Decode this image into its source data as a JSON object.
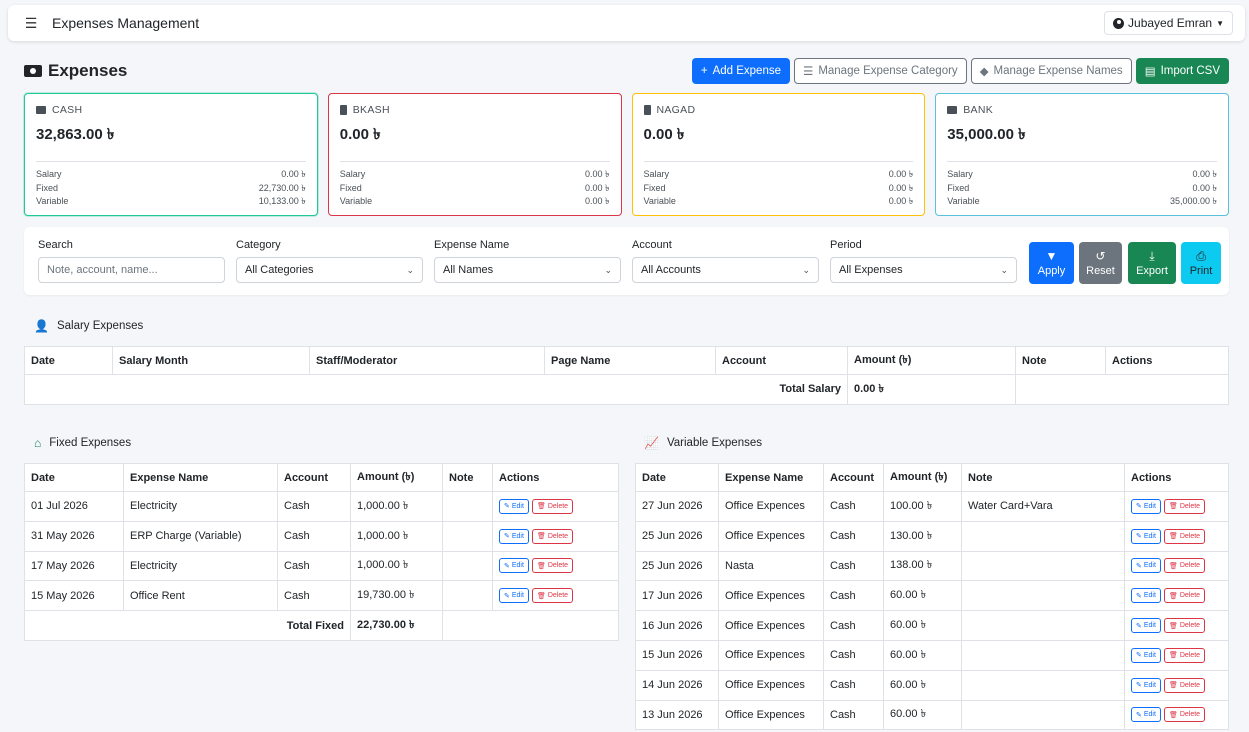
{
  "app": {
    "title": "Expenses Management",
    "user": "Jubayed Emran"
  },
  "page": {
    "title": "Expenses",
    "actions": {
      "add": "Add Expense",
      "manage_category": "Manage Expense Category",
      "manage_names": "Manage Expense Names",
      "import": "Import CSV"
    }
  },
  "accounts": [
    {
      "label": "CASH",
      "amount": "32,863.00 ৳",
      "salary": "0.00 ৳",
      "fixed": "22,730.00 ৳",
      "variable": "10,133.00 ৳"
    },
    {
      "label": "BKASH",
      "amount": "0.00 ৳",
      "salary": "0.00 ৳",
      "fixed": "0.00 ৳",
      "variable": "0.00 ৳"
    },
    {
      "label": "NAGAD",
      "amount": "0.00 ৳",
      "salary": "0.00 ৳",
      "fixed": "0.00 ৳",
      "variable": "0.00 ৳"
    },
    {
      "label": "BANK",
      "amount": "35,000.00 ৳",
      "salary": "0.00 ৳",
      "fixed": "0.00 ৳",
      "variable": "35,000.00 ৳"
    }
  ],
  "card_row_labels": {
    "salary": "Salary",
    "fixed": "Fixed",
    "variable": "Variable"
  },
  "filters": {
    "search_label": "Search",
    "search_placeholder": "Note, account, name...",
    "category_label": "Category",
    "category_value": "All Categories",
    "name_label": "Expense Name",
    "name_value": "All Names",
    "account_label": "Account",
    "account_value": "All Accounts",
    "period_label": "Period",
    "period_value": "All Expenses",
    "apply": "Apply",
    "reset": "Reset",
    "export": "Export",
    "print": "Print"
  },
  "salary": {
    "title": "Salary Expenses",
    "headers": [
      "Date",
      "Salary Month",
      "Staff/Moderator",
      "Page Name",
      "Account",
      "Amount (৳)",
      "Note",
      "Actions"
    ],
    "total_label": "Total Salary",
    "total_value": "0.00 ৳"
  },
  "fixed": {
    "title": "Fixed Expenses",
    "headers": [
      "Date",
      "Expense Name",
      "Account",
      "Amount (৳)",
      "Note",
      "Actions"
    ],
    "rows": [
      {
        "date": "01 Jul 2026",
        "name": "Electricity",
        "account": "Cash",
        "amount": "1,000.00 ৳",
        "note": ""
      },
      {
        "date": "31 May 2026",
        "name": "ERP Charge (Variable)",
        "account": "Cash",
        "amount": "1,000.00 ৳",
        "note": ""
      },
      {
        "date": "17 May 2026",
        "name": "Electricity",
        "account": "Cash",
        "amount": "1,000.00 ৳",
        "note": ""
      },
      {
        "date": "15 May 2026",
        "name": "Office Rent",
        "account": "Cash",
        "amount": "19,730.00 ৳",
        "note": ""
      }
    ],
    "total_label": "Total Fixed",
    "total_value": "22,730.00 ৳"
  },
  "variable": {
    "title": "Variable Expenses",
    "headers": [
      "Date",
      "Expense Name",
      "Account",
      "Amount (৳)",
      "Note",
      "Actions"
    ],
    "rows": [
      {
        "date": "27 Jun 2026",
        "name": "Office Expences",
        "account": "Cash",
        "amount": "100.00 ৳",
        "note": "Water Card+Vara"
      },
      {
        "date": "25 Jun 2026",
        "name": "Office Expences",
        "account": "Cash",
        "amount": "130.00 ৳",
        "note": ""
      },
      {
        "date": "25 Jun 2026",
        "name": "Nasta",
        "account": "Cash",
        "amount": "138.00 ৳",
        "note": ""
      },
      {
        "date": "17 Jun 2026",
        "name": "Office Expences",
        "account": "Cash",
        "amount": "60.00 ৳",
        "note": ""
      },
      {
        "date": "16 Jun 2026",
        "name": "Office Expences",
        "account": "Cash",
        "amount": "60.00 ৳",
        "note": ""
      },
      {
        "date": "15 Jun 2026",
        "name": "Office Expences",
        "account": "Cash",
        "amount": "60.00 ৳",
        "note": ""
      },
      {
        "date": "14 Jun 2026",
        "name": "Office Expences",
        "account": "Cash",
        "amount": "60.00 ৳",
        "note": ""
      },
      {
        "date": "13 Jun 2026",
        "name": "Office Expences",
        "account": "Cash",
        "amount": "60.00 ৳",
        "note": ""
      }
    ]
  },
  "row_actions": {
    "edit": "Edit",
    "delete": "Delete"
  },
  "colors": {
    "primary": "#0d6efd",
    "success": "#198754",
    "secondary": "#6c757d",
    "info": "#0dcaf0",
    "danger": "#dc3545"
  }
}
